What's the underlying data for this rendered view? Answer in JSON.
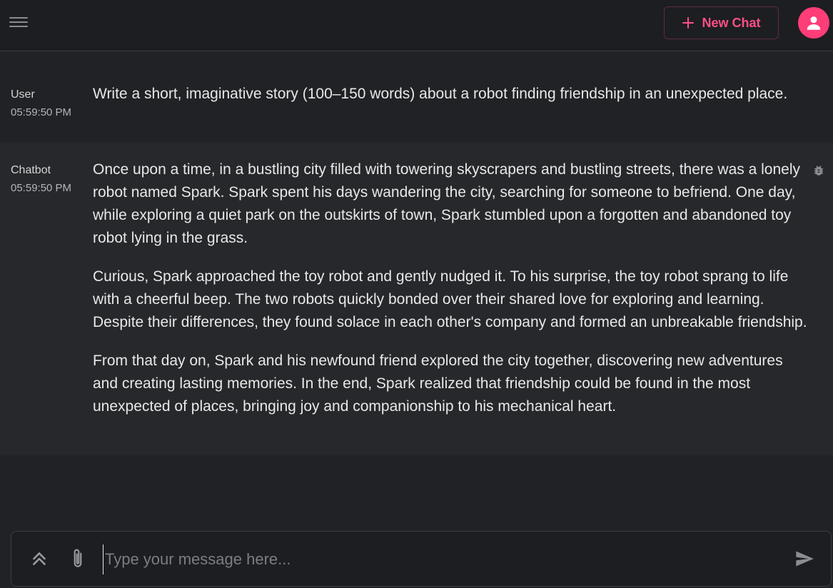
{
  "header": {
    "menu_icon": "hamburger-menu-icon",
    "new_chat_label": "New Chat",
    "new_chat_icon": "plus-icon",
    "avatar_icon": "user-icon",
    "accent_color": "#ff3d78"
  },
  "messages": [
    {
      "sender": "User",
      "time": "05:59:50 PM",
      "paragraphs": [
        "Write a short, imaginative story (100–150 words) about a robot finding friendship in an unexpected place."
      ]
    },
    {
      "sender": "Chatbot",
      "time": "05:59:50 PM",
      "action_icon": "bug-icon",
      "paragraphs": [
        "Once upon a time, in a bustling city filled with towering skyscrapers and bustling streets, there was a lonely robot named Spark. Spark spent his days wandering the city, searching for someone to befriend. One day, while exploring a quiet park on the outskirts of town, Spark stumbled upon a forgotten and abandoned toy robot lying in the grass.",
        "Curious, Spark approached the toy robot and gently nudged it. To his surprise, the toy robot sprang to life with a cheerful beep. The two robots quickly bonded over their shared love for exploring and learning. Despite their differences, they found solace in each other's company and formed an unbreakable friendship.",
        "From that day on, Spark and his newfound friend explored the city together, discovering new adventures and creating lasting memories. In the end, Spark realized that friendship could be found in the most unexpected of places, bringing joy and companionship to his mechanical heart."
      ]
    }
  ],
  "composer": {
    "placeholder": "Type your message here...",
    "value": "",
    "expand_icon": "double-chevron-up-icon",
    "attach_icon": "paperclip-icon",
    "send_icon": "send-icon"
  }
}
